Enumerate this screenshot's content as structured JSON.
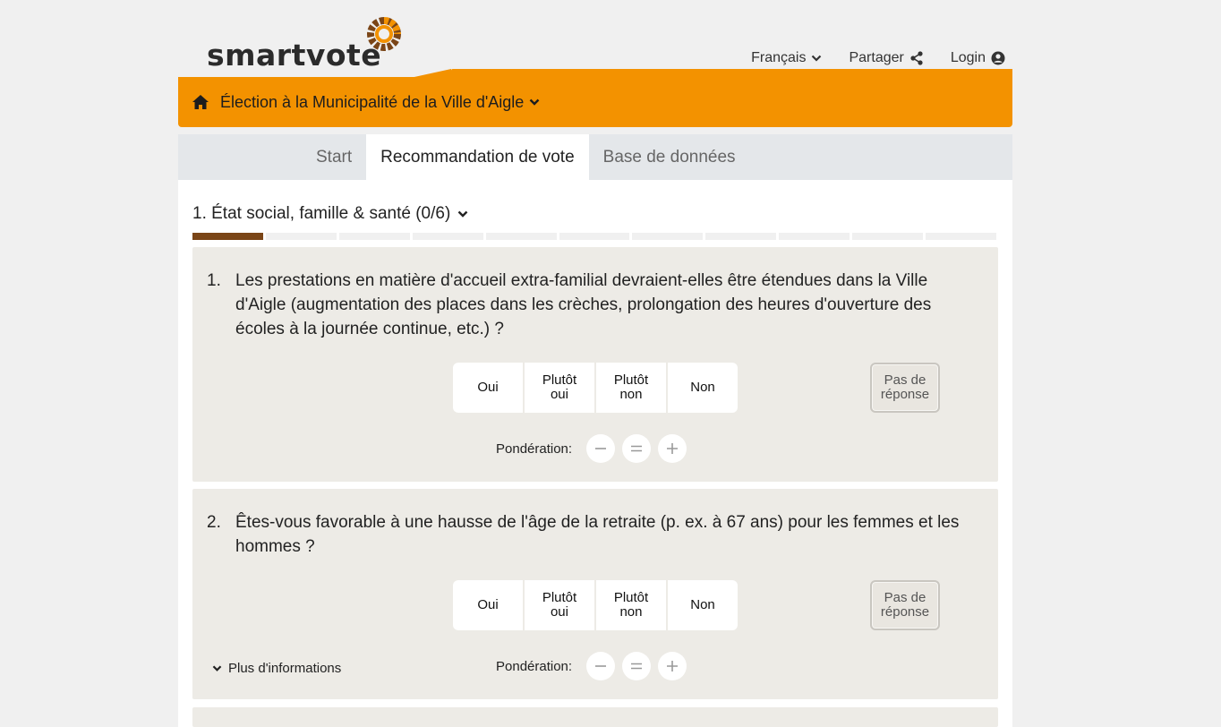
{
  "brand": {
    "name": "smartvote",
    "accent": "#f39200",
    "brown": "#7a4517"
  },
  "top_nav": {
    "language": "Français",
    "share": "Partager",
    "login": "Login"
  },
  "election": {
    "title": "Élection à la Municipalité de la Ville d'Aigle"
  },
  "tabs": [
    {
      "label": "Start",
      "active": false
    },
    {
      "label": "Recommandation de vote",
      "active": true
    },
    {
      "label": "Base de données",
      "active": false
    }
  ],
  "section": {
    "title": "1. État social, famille & santé (0/6)",
    "progress_segments": 11,
    "progress_done": 1
  },
  "answer_labels": {
    "yes": "Oui",
    "rather_yes_1": "Plutôt",
    "rather_yes_2": "oui",
    "rather_no_1": "Plutôt",
    "rather_no_2": "non",
    "no": "Non",
    "no_answer_1": "Pas de",
    "no_answer_2": "réponse",
    "weighting": "Pondération:",
    "more_info": "Plus d'informations"
  },
  "questions": [
    {
      "number": "1.",
      "text": "Les prestations en matière d'accueil extra-familial devraient-elles être étendues dans la Ville d'Aigle (augmentation des places dans les crèches, prolongation des heures d'ouverture des écoles à la journée continue, etc.) ?"
    },
    {
      "number": "2.",
      "text": "Êtes-vous favorable à une hausse de l'âge de la retraite (p. ex. à 67 ans) pour les femmes et les hommes ?"
    }
  ],
  "icons": [
    "logo-ring-icon",
    "chevron-down-icon",
    "share-icon",
    "user-circle-icon",
    "home-icon",
    "minus-icon",
    "equals-icon",
    "plus-icon"
  ]
}
